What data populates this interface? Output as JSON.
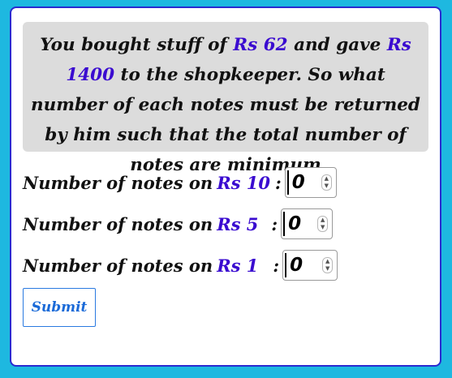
{
  "question": {
    "part1": "You bought stuff of ",
    "price": "Rs 62",
    "part2": " and gave ",
    "paid": "Rs 1400",
    "part3": " to the shopkeeper. So what number of each notes must be returned by him such that the total number of notes are minimum"
  },
  "rows": [
    {
      "label": "Number of notes on ",
      "denomination": "Rs 10",
      "colon": ":",
      "value": "0"
    },
    {
      "label": "Number of notes on ",
      "denomination": "Rs 5",
      "colon": ":",
      "value": "0"
    },
    {
      "label": "Number of notes on ",
      "denomination": "Rs 1",
      "colon": ":",
      "value": "0"
    }
  ],
  "submit_label": "Submit",
  "spinner": {
    "up": "▲",
    "down": "▼"
  },
  "colors": {
    "background": "#1eb8e0",
    "card_border": "#2a2ad0",
    "accent": "#3a0bd0",
    "question_bg": "#dcdcdc",
    "submit": "#1a6ad8"
  }
}
